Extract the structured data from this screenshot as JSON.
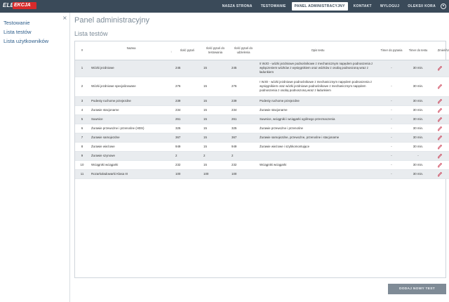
{
  "nav": {
    "logo_left": "ELE",
    "logo_right": "EKCJA",
    "items": [
      {
        "label": "NASZA STRONA",
        "active": false
      },
      {
        "label": "TESTOWANIE",
        "active": false
      },
      {
        "label": "PANEL ADMINISTRACYJNY",
        "active": true
      },
      {
        "label": "KONTAKT",
        "active": false
      },
      {
        "label": "WYLOGUJ",
        "active": false
      },
      {
        "label": "OLEKSII KORA",
        "active": false
      }
    ]
  },
  "sidebar": {
    "close_symbol": "×",
    "items": [
      "Testowanie",
      "Lista testów",
      "Lista użytkowników"
    ]
  },
  "main": {
    "page_title": "Panel administracyjny",
    "section_title": "Lista testów",
    "add_button": "DODAJ NOWY TEST"
  },
  "table": {
    "headers": [
      "#",
      "Nazwa",
      "Ilość pytań",
      "Ilość pytań do testowania",
      "Ilość pytań do udzielenia",
      "Opis testu",
      "Timer do pytania",
      "Timer do testu",
      "Zmień/Usuń"
    ],
    "sort_symbol": "↕",
    "rows": [
      [
        "1",
        "Wózki jezdniowe",
        "245",
        "15",
        "245",
        "II WJO - wózki jezdniowe podnośnikowe z mechanicznym napędem podnoszenia z wyłączeniem wózków z wysięgnikiem oraz wózków z osobą podnoszoną wraz z ładunkiem",
        "-",
        "30 min."
      ],
      [
        "2",
        "Wózki jezdniowe specjalizowane",
        "276",
        "15",
        "276",
        "I WJO - wózki jezdniowe podnośnikowe z mechanicznym napędem podnoszenia z wysięgnikiem oraz wózki jezdniowe podnośnikowe z mechanicznym napędem podnoszenia z osobą podnoszoną wraz z ładunkiem",
        "-",
        "30 min."
      ],
      [
        "3",
        "Podesty ruchome przejezdne",
        "239",
        "15",
        "239",
        "Podesty ruchome przejezdne",
        "-",
        "30 min."
      ],
      [
        "4",
        "Żurawie stacjonarne",
        "234",
        "15",
        "234",
        "Żurawie stacjonarne",
        "-",
        "30 min."
      ],
      [
        "5",
        "Suwnice",
        "261",
        "15",
        "261",
        "Suwnice, wciągniki i wciągarki ogólnego przeznaczenia",
        "-",
        "30 min."
      ],
      [
        "6",
        "Żurawie przewożne i przenośne (HDS)",
        "325",
        "15",
        "325",
        "Żurawie przewożne i przenośne",
        "-",
        "30 min."
      ],
      [
        "7",
        "Żurawie samojezdne",
        "367",
        "15",
        "367",
        "Żurawie samojezdne, przewożne, przenośne i stacjonarne",
        "-",
        "30 min."
      ],
      [
        "8",
        "Żurawie wieżowe",
        "949",
        "15",
        "949",
        "Żurawie wieżowe i szybkomontujące",
        "-",
        "30 min."
      ],
      [
        "9",
        "Żurawie szynowe",
        "2",
        "2",
        "2",
        "",
        "-",
        "-"
      ],
      [
        "10",
        "Wciągniki wciągarki",
        "232",
        "15",
        "232",
        "Wciągniki wciągarki",
        "-",
        "30 min."
      ],
      [
        "11",
        "Rozarkoładowarki Klasa III",
        "100",
        "100",
        "100",
        "",
        "-",
        "30 min."
      ]
    ]
  },
  "colors": {
    "nav_bg": "#3a4a59",
    "link": "#2d5d8a",
    "edit": "#c8324a",
    "trash": "#5a6a78",
    "button_bg": "#7f8b96",
    "row_alt": "#e9ecef"
  },
  "icons": {
    "edit": "pencil-icon",
    "delete": "trash-icon",
    "user": "user-icon",
    "sort": "sort-icon"
  }
}
